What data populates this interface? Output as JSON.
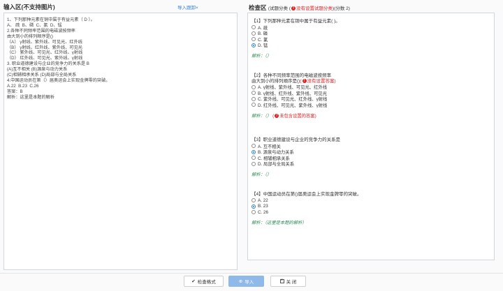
{
  "left": {
    "title": "输入区(不支持图片)",
    "import_link": "导入跟卸×",
    "raw_lines": [
      "1、下列那种元素在铜中属于有益元素（ D ）。",
      "A、 疏  B、磷  C、氯  D、锰",
      "2.各种不同频率范围的电磁波按频率",
      "由大到小的排列顺序是()",
      "（A） γ射线、紫外线、可见光、红外线",
      "（B） γ射线、红外线、紫外线、可见光",
      "（C） 紫外线、可见光、红外线、γ射线",
      "（D） 红外线、可见光、紫外线、γ射线",
      "3. 职业道德建设与企业的竞争力的关系是 B",
      "(A)互不相关 (B)源泉与动力关系",
      "(C)相辅相承关系 (D)局部与全局关系",
      "4.中国运动员在第（）届奥运会上实现金牌零的突破。",
      "A.22  B.23  C.26",
      "答案：B",
      "解析：这里是本题的解析"
    ]
  },
  "right": {
    "title": "检查区",
    "sub_label": "(试题分类 (",
    "warn_text": "没有设置试题分类",
    "score_text": ")(分数 2)"
  },
  "questions": [
    {
      "stem": "【1】下列那种元素在铜中属于有益元素( )。",
      "options": [
        "A. 疏",
        "B. 磷",
        "C. 氯",
        "D. 锰"
      ],
      "checked": 3,
      "analysis": "解析：（）",
      "warn": ""
    },
    {
      "stem": "【2】各种不同频率范围的电磁波按频率",
      "stem2": "由大到小的排列顺序是()",
      "stem2_warn": "没有设置答案",
      "options": [
        "A. γ射线、紫外线、可见光、红外线",
        "B. γ射线、红外线、紫外线、可见光",
        "C. 紫外线、可见光、红外线、γ射线",
        "D. 红外线、可见光、紫外线、γ射线"
      ],
      "checked": -1,
      "analysis": "解析：（）",
      "warn": "未包含设置的答案"
    },
    {
      "stem": "【3】职业道德建设与企业的竞争力的关系是",
      "options": [
        "A. 互不相关",
        "B. 源泉与动力关系",
        "C. 相辅相承关系",
        "D. 局部与全局关系"
      ],
      "checked": 1,
      "analysis": "解析：（）",
      "warn": ""
    },
    {
      "stem": "【4】中国运动员在第()届奥运会上实现金牌零的突破。",
      "options": [
        "A. 22",
        "B. 23",
        "C. 26"
      ],
      "checked": 1,
      "analysis": "解析：（这里是本题的解析）",
      "warn": ""
    }
  ],
  "footer": {
    "check_label": "检查格式",
    "import_label": "导入",
    "close_label": "关 闭"
  },
  "colors": {
    "accent": "#2f7fd8",
    "warn": "#e02020",
    "analysis": "#2e8b57"
  }
}
